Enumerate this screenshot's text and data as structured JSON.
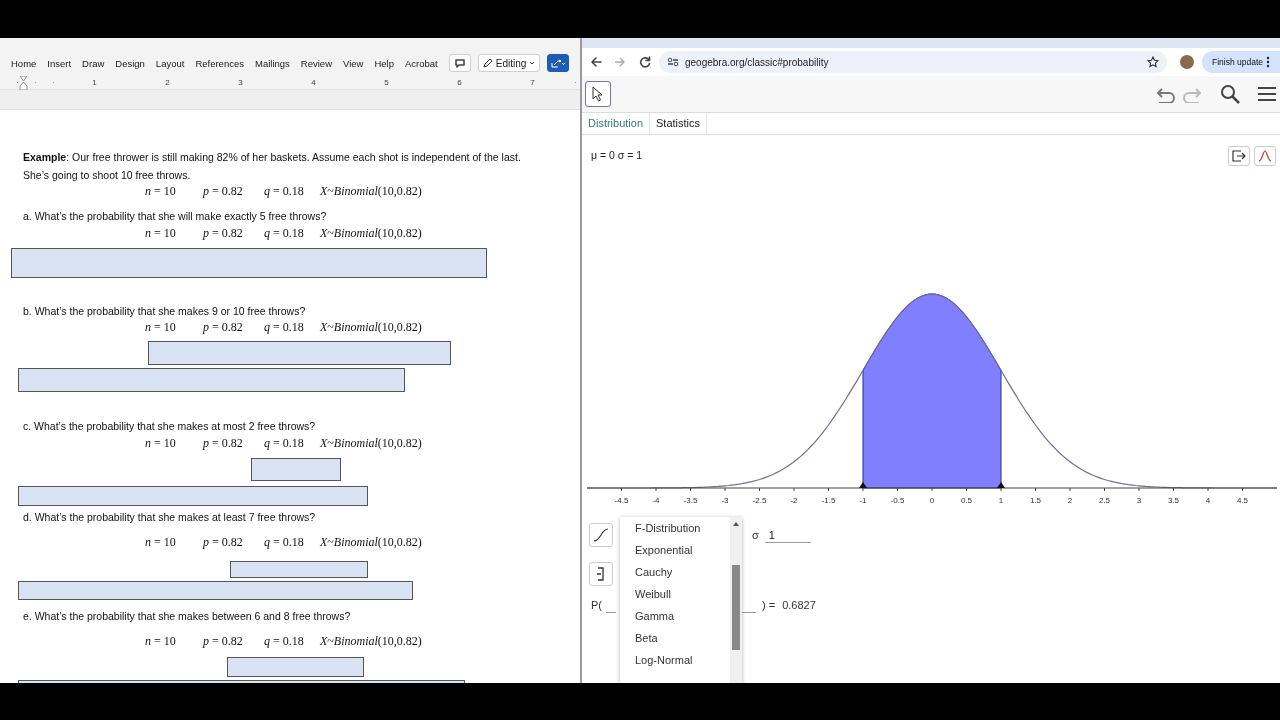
{
  "word": {
    "ribbon_tabs": [
      "Home",
      "Insert",
      "Draw",
      "Design",
      "Layout",
      "References",
      "Mailings",
      "Review",
      "View",
      "Help",
      "Acrobat"
    ],
    "editing_button": "Editing",
    "ruler_labels": [
      "1",
      "2",
      "3",
      "4",
      "5",
      "6",
      "7"
    ],
    "document": {
      "example_lines": [
        "**Example**: Our free thrower is still making 82% of her baskets. Assume each shot is independent of the last.",
        "She’s going to shoot 10 free throws."
      ],
      "formula": [
        "*n* = 10",
        "*p* = 0.82",
        "*q* = 0.18",
        "*X*~*Binomial*(10,0.82)"
      ],
      "questions": [
        {
          "text": "a. What’s the probability that she will make exactly 5 free throws?",
          "formula": [
            "*n* = 10",
            "*p* = 0.82",
            "*q* = 0.18",
            "*X*~*Binomial*(10,0.82)"
          ]
        },
        {
          "text": "b. What’s the probability that she makes 9 or 10 free throws?",
          "formula": [
            "*n* = 10",
            "*p* = 0.82",
            "*q* = 0.18",
            "*X*~*Binomial*(10,0.82)"
          ]
        },
        {
          "text": "c. What’s the probability that she makes at most 2 free throws?",
          "formula": [
            "*n* = 10",
            "*p* = 0.82",
            "*q* = 0.18",
            "*X*~*Binomial*(10,0.82)"
          ]
        },
        {
          "text": "d. What’s the probability that she makes at least 7 free throws?",
          "formula": [
            "*n* = 10",
            "*p* = 0.82",
            "*q* = 0.18",
            "*X*~*Binomial*(10,0.82)"
          ]
        },
        {
          "text": "e. What’s the probability that she makes between 6 and 8 free throws?",
          "formula": [
            "*n* = 10",
            "*p* = 0.82",
            "*q* = 0.18",
            "*X*~*Binomial*(10,0.82)"
          ]
        }
      ]
    }
  },
  "browser": {
    "url": "geogebra.org/classic#probability",
    "update_button": "Finish update"
  },
  "geogebra": {
    "tabs": [
      {
        "label": "Distribution",
        "selected": true
      },
      {
        "label": "Statistics",
        "selected": false
      }
    ],
    "parameters_readout": "μ = 0 σ = 1",
    "x_tick_labels": [
      "-4.5",
      "-4",
      "-3.5",
      "-3",
      "-2.5",
      "-2",
      "-1.5",
      "-1",
      "-0.5",
      "0",
      "0.5",
      "1",
      "1.5",
      "2",
      "2.5",
      "3",
      "3.5",
      "4",
      "4.5"
    ],
    "sigma_label": "σ",
    "sigma_value": "1",
    "probability_prefix": "P(",
    "probability_suffix": ") =",
    "probability_value": "0.6827",
    "distribution_options": [
      {
        "label": "F-Distribution",
        "selected": false
      },
      {
        "label": "Exponential",
        "selected": false
      },
      {
        "label": "Cauchy",
        "selected": false
      },
      {
        "label": "Weibull",
        "selected": false
      },
      {
        "label": "Gamma",
        "selected": false
      },
      {
        "label": "Beta",
        "selected": false
      },
      {
        "label": "Log-Normal",
        "selected": false
      }
    ]
  }
}
